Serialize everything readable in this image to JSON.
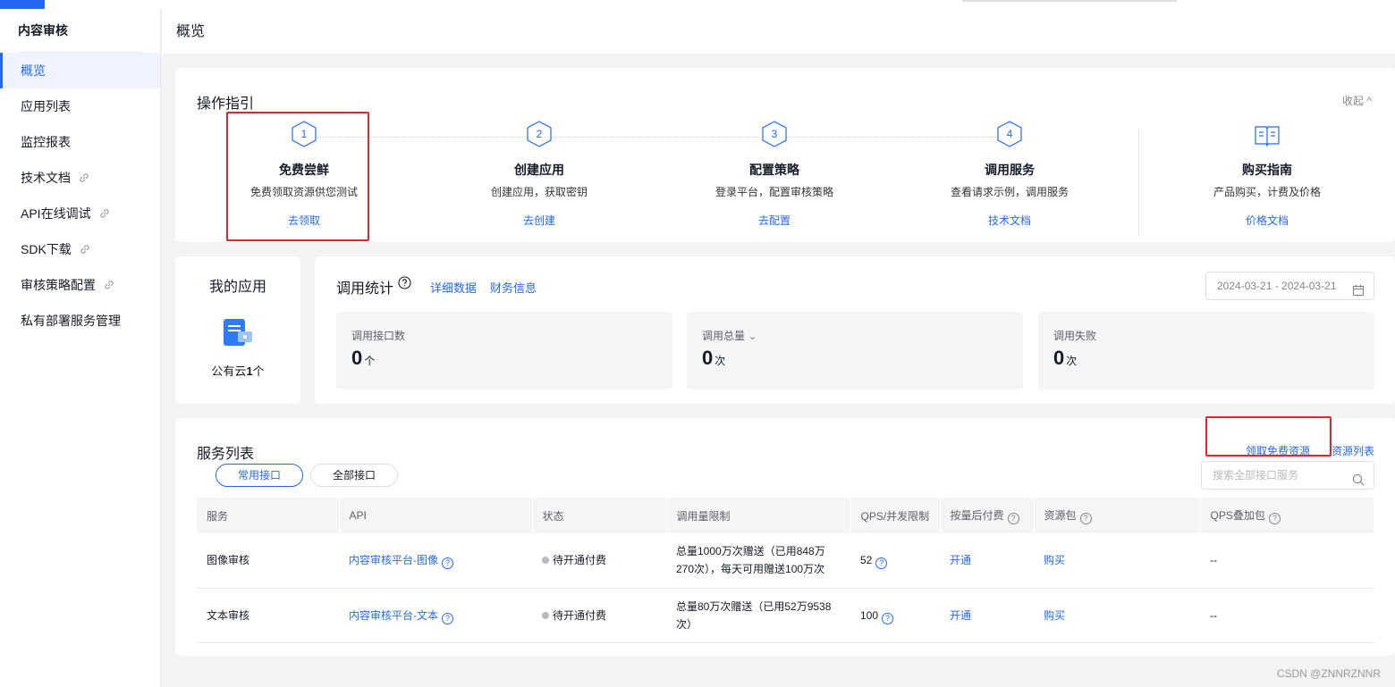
{
  "sidebar": {
    "title": "内容审核",
    "items": [
      {
        "label": "概览"
      },
      {
        "label": "应用列表"
      },
      {
        "label": "监控报表"
      },
      {
        "label": "技术文档"
      },
      {
        "label": "API在线调试"
      },
      {
        "label": "SDK下载"
      },
      {
        "label": "审核策略配置"
      },
      {
        "label": "私有部署服务管理"
      }
    ]
  },
  "page": {
    "title": "概览"
  },
  "guide": {
    "title": "操作指引",
    "collapse": "收起",
    "steps": [
      {
        "num": "1",
        "title": "免费尝鲜",
        "desc": "免费领取资源供您测试",
        "link": "去领取"
      },
      {
        "num": "2",
        "title": "创建应用",
        "desc": "创建应用，获取密钥",
        "link": "去创建"
      },
      {
        "num": "3",
        "title": "配置策略",
        "desc": "登录平台，配置审核策略",
        "link": "去配置"
      },
      {
        "num": "4",
        "title": "调用服务",
        "desc": "查看请求示例，调用服务",
        "link": "技术文档"
      }
    ],
    "buy": {
      "title": "购买指南",
      "desc": "产品购买，计费及价格",
      "link": "价格文档"
    }
  },
  "my_apps": {
    "title": "我的应用",
    "label": "公有云",
    "count": "1",
    "unit": "个"
  },
  "stats": {
    "title": "调用统计",
    "links": [
      "详细数据",
      "财务信息"
    ],
    "date_range": "2024-03-21 - 2024-03-21",
    "boxes": [
      {
        "label": "调用接口数",
        "value": "0",
        "unit": "个"
      },
      {
        "label": "调用总量",
        "value": "0",
        "unit": "次"
      },
      {
        "label": "调用失败",
        "value": "0",
        "unit": "次"
      }
    ]
  },
  "services": {
    "title": "服务列表",
    "links": [
      "领取免费资源",
      "资源列表"
    ],
    "tabs": [
      "常用接口",
      "全部接口"
    ],
    "search_placeholder": "搜索全部接口服务",
    "columns": [
      "服务",
      "API",
      "状态",
      "调用量限制",
      "QPS/并发限制",
      "按量后付费",
      "资源包",
      "QPS叠加包"
    ],
    "rows": [
      {
        "service": "图像审核",
        "api": "内容审核平台-图像",
        "status": "待开通付费",
        "limit": "总量1000万次赠送（已用848万270次），每天可用赠送100万次",
        "qps": "52",
        "postpaid": "开通",
        "package": "购买",
        "qps_pack": "--"
      },
      {
        "service": "文本审核",
        "api": "内容审核平台-文本",
        "status": "待开通付费",
        "limit": "总量80万次赠送（已用52万9538次）",
        "qps": "100",
        "postpaid": "开通",
        "package": "购买",
        "qps_pack": "--"
      }
    ]
  },
  "watermark": "CSDN @ZNNRZNNR",
  "colors": {
    "accent": "#2468f2",
    "highlight_box": "#e4262b",
    "sidebar_active_bg": "#eef3fe"
  }
}
